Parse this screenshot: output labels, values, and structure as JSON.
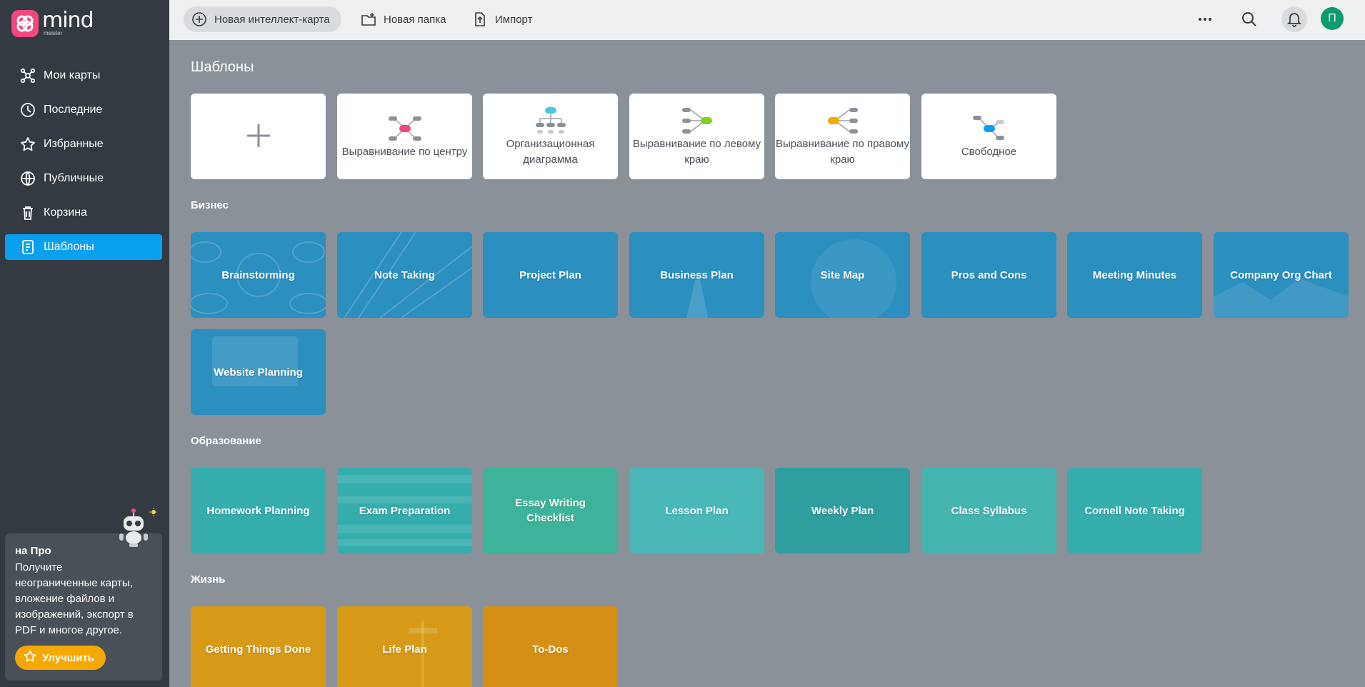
{
  "brand": {
    "name": "mind",
    "sub": "meister",
    "color": "#f2487d"
  },
  "sidebar": {
    "items": [
      {
        "label": "Мои карты",
        "icon": "mindmap-icon"
      },
      {
        "label": "Последние",
        "icon": "clock-icon"
      },
      {
        "label": "Избранные",
        "icon": "star-icon"
      },
      {
        "label": "Публичные",
        "icon": "globe-icon"
      },
      {
        "label": "Корзина",
        "icon": "trash-icon"
      },
      {
        "label": "Шаблоны",
        "icon": "template-icon",
        "active": true
      }
    ],
    "promo": {
      "title": "на Про",
      "text": "Получите неограниченные карты, вложение файлов и изображений, экспорт в PDF и многое другое.",
      "button": "Улучшить"
    }
  },
  "topbar": {
    "new_map": "Новая интеллект-карта",
    "new_folder": "Новая папка",
    "import": "Импорт",
    "avatar_initial": "П"
  },
  "main": {
    "title": "Шаблоны",
    "basic_templates": [
      {
        "label": "",
        "icon": "plus-icon"
      },
      {
        "label": "Выравнивание по центру",
        "icon": "center-layout-icon"
      },
      {
        "label": "Организационная диаграмма",
        "icon": "org-chart-icon"
      },
      {
        "label": "Выравнивание по левому краю",
        "icon": "left-layout-icon"
      },
      {
        "label": "Выравнивание по правому краю",
        "icon": "right-layout-icon"
      },
      {
        "label": "Свободное",
        "icon": "free-layout-icon"
      }
    ],
    "sections": [
      {
        "title": "Бизнес",
        "color": "#2b8fbf",
        "items": [
          "Brainstorming",
          "Note Taking",
          "Project Plan",
          "Business Plan",
          "Site Map",
          "Pros and Cons",
          "Meeting Minutes",
          "Company Org Chart",
          "Website Planning"
        ]
      },
      {
        "title": "Образование",
        "color": "#36adad",
        "items": [
          "Homework Planning",
          "Exam Preparation",
          "Essay Writing Checklist",
          "Lesson Plan",
          "Weekly Plan",
          "Class Syllabus",
          "Cornell Note Taking"
        ]
      },
      {
        "title": "Жизнь",
        "color": "#d79a18",
        "items": [
          "Getting Things Done",
          "Life Plan",
          "To-Dos"
        ]
      }
    ]
  }
}
